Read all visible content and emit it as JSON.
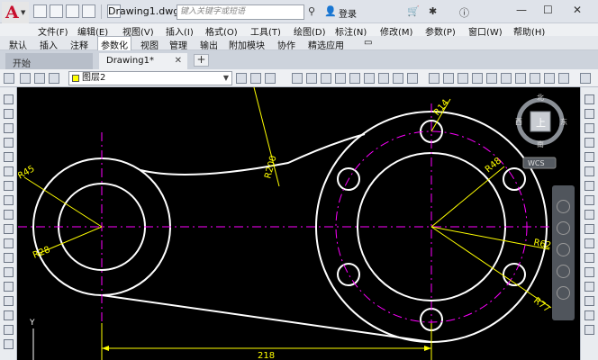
{
  "app": {
    "doc_title": "Drawing1.dwg",
    "search_placeholder": "键入关键字或短语",
    "login": "登录"
  },
  "menu": [
    "文件(F)",
    "编辑(E)",
    "视图(V)",
    "插入(I)",
    "格式(O)",
    "工具(T)",
    "绘图(D)",
    "标注(N)",
    "修改(M)",
    "参数(P)",
    "窗口(W)",
    "帮助(H)"
  ],
  "ribbon_tabs": [
    "默认",
    "插入",
    "注释",
    "参数化",
    "视图",
    "管理",
    "输出",
    "附加模块",
    "协作",
    "精选应用"
  ],
  "active_ribbon_tab": "参数化",
  "file_tabs": {
    "start": "开始",
    "drawing": "Drawing1*"
  },
  "layer": {
    "name": "图层2",
    "color": "#ffff00"
  },
  "viewcube": {
    "north": "北",
    "south": "南",
    "east": "东",
    "west": "西",
    "top": "上",
    "wcs": "WCS"
  },
  "axis": {
    "y": "Y"
  },
  "dimensions": {
    "r45": "R45",
    "r28": "R28",
    "r200": "R200",
    "r14": "R14",
    "r48": "R48",
    "r62": "R62",
    "r77": "R77",
    "len": "218"
  },
  "colors": {
    "dim": "#ffff00",
    "geometry": "#ffffff",
    "center": "#ff00ff",
    "accent": "#c8102e"
  }
}
